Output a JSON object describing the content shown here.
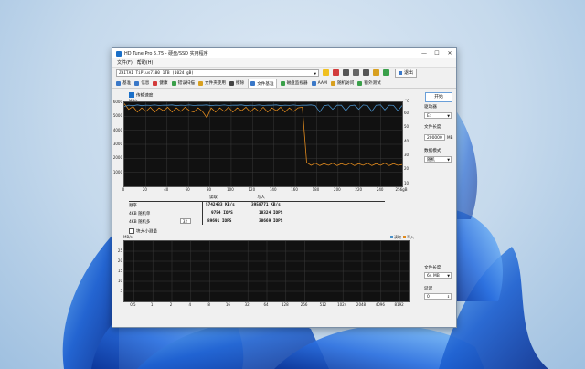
{
  "window": {
    "title": "HD Tune Pro 5.75 - 硬盘/SSD 实用程序",
    "controls": [
      "—",
      "☐",
      "✕"
    ]
  },
  "menu": [
    "文件(F)",
    "帮助(H)"
  ],
  "drive": {
    "selected": "ZHITAI TiPlus7100 1TB (1024 gB)",
    "exit_label": "退出"
  },
  "tabs": [
    {
      "label": "基准",
      "color": "#3a78c8"
    },
    {
      "label": "信息",
      "color": "#3a78c8"
    },
    {
      "label": "健康",
      "color": "#d23b3b"
    },
    {
      "label": "错误扫描",
      "color": "#3aa04a"
    },
    {
      "label": "文件夹使用",
      "color": "#d8a020"
    },
    {
      "label": "擦除",
      "color": "#444444"
    },
    {
      "label": "文件基准",
      "color": "#3a78c8",
      "active": true
    },
    {
      "label": "磁盘监视器",
      "color": "#3aa04a"
    },
    {
      "label": "AAM",
      "color": "#3a78c8"
    },
    {
      "label": "随机访问",
      "color": "#d8a020"
    },
    {
      "label": "额外测试",
      "color": "#3aa04a"
    }
  ],
  "transfer": {
    "checkbox_label": "传输速度",
    "unit": "MB/s",
    "right_unit": "°C",
    "y_ticks": [
      "6000",
      "5000",
      "4000",
      "3000",
      "2000",
      "1000"
    ],
    "right_ticks": [
      "60",
      "50",
      "40",
      "30",
      "20",
      "10"
    ],
    "x_ticks": [
      "0",
      "20",
      "40",
      "60",
      "80",
      "100",
      "120",
      "140",
      "160",
      "180",
      "200",
      "220",
      "240",
      "256gB"
    ]
  },
  "results": {
    "header_read": "读取",
    "header_write": "写入",
    "rows": [
      {
        "label": "顺序",
        "read": "5742433 KB/s",
        "write": "3958771 KB/s"
      },
      {
        "label": "4KB 随机单",
        "read": "9754 IOPS",
        "write": "10324 IOPS"
      },
      {
        "label": "4KB 随机多",
        "queue": "32",
        "read": "89691 IOPS",
        "write": "30669 IOPS"
      }
    ]
  },
  "block": {
    "checkbox_label": "块大小测量",
    "unit": "MB/s",
    "legend_read": "读取",
    "legend_write": "写入",
    "y_ticks": [
      "25",
      "20",
      "15",
      "10",
      "5"
    ],
    "x_ticks": [
      "0.5",
      "1",
      "2",
      "4",
      "8",
      "16",
      "32",
      "64",
      "128",
      "256",
      "512",
      "1024",
      "2048",
      "4096",
      "8192"
    ]
  },
  "side": {
    "start_label": "开始",
    "drive_label": "驱动器",
    "drive_value": "E:",
    "file_length_label": "文件长度",
    "file_length_value": "200000",
    "file_length_unit": "MB",
    "data_mode_label": "数据模式",
    "data_mode_value": "随机",
    "file_length2_label": "文件长度",
    "file_length2_value": "64 MB",
    "delay_label": "延迟",
    "delay_value": "0"
  },
  "chart_data": {
    "type": "line",
    "xlabel": "",
    "ylabel": "MB/s",
    "xlim": [
      0,
      256
    ],
    "ylim": [
      0,
      6000
    ],
    "series": [
      {
        "color": "#e08a1e",
        "x": [
          0,
          4,
          8,
          12,
          16,
          20,
          24,
          28,
          32,
          36,
          40,
          44,
          48,
          52,
          56,
          60,
          64,
          68,
          72,
          76,
          80,
          84,
          88,
          92,
          96,
          100,
          104,
          108,
          112,
          116,
          120,
          124,
          128,
          132,
          136,
          140,
          144,
          148,
          152,
          156,
          160,
          164,
          168,
          172,
          176,
          180,
          184,
          188,
          192,
          196,
          200,
          204,
          208,
          212,
          216,
          220,
          224,
          228,
          232,
          236,
          240,
          244,
          248,
          252,
          256
        ],
        "y": [
          5900,
          5500,
          5700,
          5300,
          5600,
          5350,
          5650,
          5300,
          5600,
          5400,
          5650,
          5300,
          5600,
          5350,
          5650,
          5400,
          5300,
          5600,
          5350,
          4900,
          5600,
          5300,
          5600,
          5350,
          5650,
          5300,
          5600,
          5400,
          5650,
          5300,
          5600,
          5350,
          5650,
          5300,
          5600,
          5400,
          5650,
          5300,
          5600,
          5350,
          5600,
          5650,
          1700,
          1500,
          1650,
          1480,
          1620,
          1500,
          1650,
          1480,
          1620,
          1500,
          1650,
          1480,
          1620,
          1500,
          1650,
          1480,
          1620,
          1500,
          1650,
          1480,
          1620,
          1500,
          1550
        ]
      },
      {
        "color": "#4a90c8",
        "x": [
          0,
          4,
          8,
          12,
          16,
          20,
          24,
          28,
          32,
          36,
          40,
          44,
          48,
          52,
          56,
          60,
          64,
          68,
          72,
          76,
          80,
          84,
          88,
          92,
          96,
          100,
          104,
          108,
          112,
          116,
          120,
          124,
          128,
          132,
          136,
          140,
          144,
          148,
          152,
          156,
          160,
          164,
          168,
          172,
          176,
          180,
          184,
          188,
          192,
          196,
          200,
          204,
          208,
          212,
          216,
          220,
          224,
          228,
          232,
          236,
          240,
          244,
          248,
          252,
          256
        ],
        "y": [
          5700,
          5800,
          5750,
          5820,
          5760,
          5800,
          5780,
          5810,
          5770,
          5800,
          5790,
          5820,
          5760,
          5800,
          5780,
          5810,
          5770,
          5800,
          5790,
          5820,
          5760,
          5800,
          5780,
          5810,
          5770,
          5800,
          5790,
          5820,
          5760,
          5800,
          5780,
          5810,
          5770,
          5800,
          5790,
          5820,
          5760,
          5800,
          5780,
          5810,
          5770,
          5800,
          5790,
          5820,
          5760,
          5300,
          5750,
          5810,
          5500,
          5800,
          5790,
          5400,
          5760,
          5800,
          5500,
          5810,
          5770,
          5350,
          5790,
          5820,
          5450,
          5800,
          5780,
          5400,
          5770
        ]
      }
    ]
  }
}
